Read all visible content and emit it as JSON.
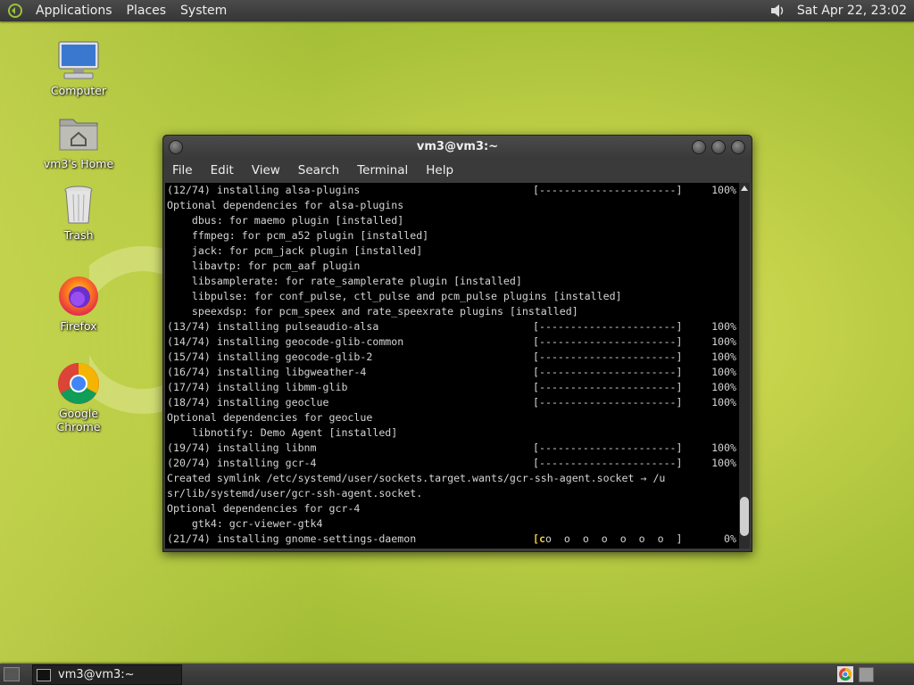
{
  "top_panel": {
    "menus": [
      "Applications",
      "Places",
      "System"
    ],
    "clock": "Sat Apr 22, 23:02"
  },
  "desktop_icons": [
    {
      "label": "Computer",
      "icon": "computer-icon"
    },
    {
      "label": "vm3's Home",
      "icon": "home-folder-icon"
    },
    {
      "label": "Trash",
      "icon": "trash-icon"
    },
    {
      "label": "Firefox",
      "icon": "firefox-icon"
    },
    {
      "label": "Google Chrome",
      "icon": "chrome-icon"
    }
  ],
  "terminal": {
    "title": "vm3@vm3:~",
    "menus": [
      "File",
      "Edit",
      "View",
      "Search",
      "Terminal",
      "Help"
    ],
    "lines": [
      {
        "text": "(12/74) installing alsa-plugins",
        "bar": "[----------------------]",
        "pct": "100%"
      },
      {
        "text": "Optional dependencies for alsa-plugins"
      },
      {
        "text": "    dbus: for maemo plugin [installed]"
      },
      {
        "text": "    ffmpeg: for pcm_a52 plugin [installed]"
      },
      {
        "text": "    jack: for pcm_jack plugin [installed]"
      },
      {
        "text": "    libavtp: for pcm_aaf plugin"
      },
      {
        "text": "    libsamplerate: for rate_samplerate plugin [installed]"
      },
      {
        "text": "    libpulse: for conf_pulse, ctl_pulse and pcm_pulse plugins [installed]"
      },
      {
        "text": "    speexdsp: for pcm_speex and rate_speexrate plugins [installed]"
      },
      {
        "text": "(13/74) installing pulseaudio-alsa",
        "bar": "[----------------------]",
        "pct": "100%"
      },
      {
        "text": "(14/74) installing geocode-glib-common",
        "bar": "[----------------------]",
        "pct": "100%"
      },
      {
        "text": "(15/74) installing geocode-glib-2",
        "bar": "[----------------------]",
        "pct": "100%"
      },
      {
        "text": "(16/74) installing libgweather-4",
        "bar": "[----------------------]",
        "pct": "100%"
      },
      {
        "text": "(17/74) installing libmm-glib",
        "bar": "[----------------------]",
        "pct": "100%"
      },
      {
        "text": "(18/74) installing geoclue",
        "bar": "[----------------------]",
        "pct": "100%"
      },
      {
        "text": "Optional dependencies for geoclue"
      },
      {
        "text": "    libnotify: Demo Agent [installed]"
      },
      {
        "text": "(19/74) installing libnm",
        "bar": "[----------------------]",
        "pct": "100%"
      },
      {
        "text": "(20/74) installing gcr-4",
        "bar": "[----------------------]",
        "pct": "100%"
      },
      {
        "text": "Created symlink /etc/systemd/user/sockets.target.wants/gcr-ssh-agent.socket → /u"
      },
      {
        "text": "sr/lib/systemd/user/gcr-ssh-agent.socket."
      },
      {
        "text": "Optional dependencies for gcr-4"
      },
      {
        "text": "    gtk4: gcr-viewer-gtk4"
      },
      {
        "text": "(21/74) installing gnome-settings-daemon",
        "bar_hl": "[c",
        "bar": "o  o  o  o  o  o  o  ]",
        "pct": "0%"
      }
    ]
  },
  "taskbar": {
    "window_button": "vm3@vm3:~"
  }
}
